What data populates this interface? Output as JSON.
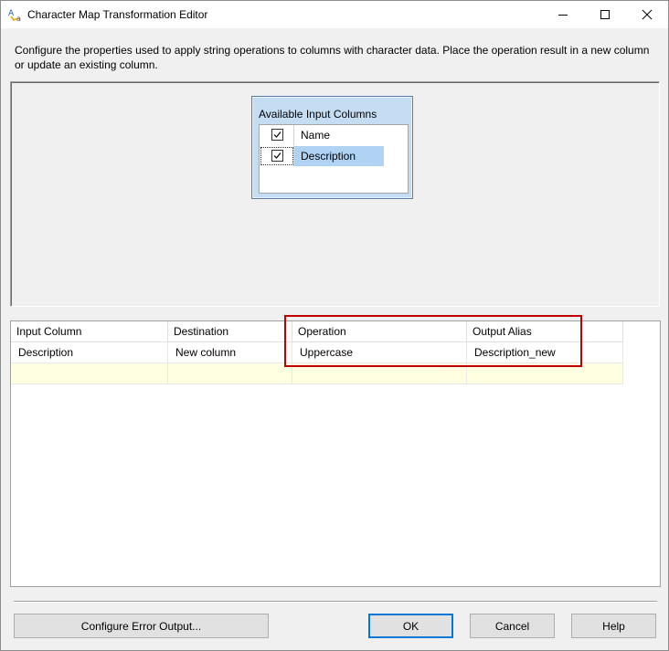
{
  "window": {
    "title": "Character Map Transformation Editor",
    "icons": {
      "app": "character-map-icon",
      "minimize": "minimize-icon",
      "maximize": "maximize-icon",
      "close": "close-icon"
    }
  },
  "description": "Configure the properties used to apply string operations to columns with character data. Place the operation result in a new column or update an existing column.",
  "available_columns": {
    "title": "Available Input Columns",
    "items": [
      {
        "label": "Name",
        "checked": true,
        "selected": false
      },
      {
        "label": "Description",
        "checked": true,
        "selected": true
      }
    ]
  },
  "grid": {
    "headers": [
      "Input Column",
      "Destination",
      "Operation",
      "Output Alias"
    ],
    "rows": [
      [
        "Description",
        "New column",
        "Uppercase",
        "Description_new"
      ]
    ],
    "new_row_color": "#ffffe1"
  },
  "highlight_color": "#c00000",
  "buttons": {
    "configure_error_output": "Configure Error Output...",
    "ok": "OK",
    "cancel": "Cancel",
    "help": "Help"
  }
}
